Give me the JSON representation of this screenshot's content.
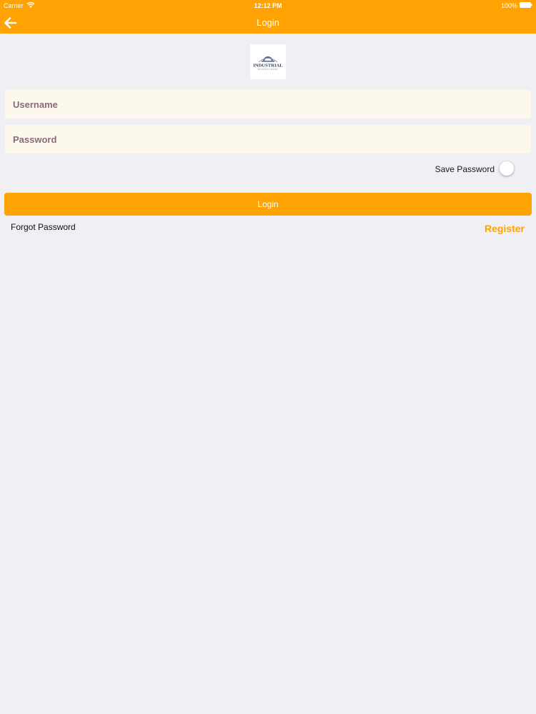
{
  "status_bar": {
    "carrier": "Carrier",
    "time": "12:12 PM",
    "battery": "100%"
  },
  "nav": {
    "title": "Login",
    "back_icon": "arrow-left-icon"
  },
  "logo": {
    "text": "INDUSTRIAL",
    "subtext": "BUSINESS CREDIT"
  },
  "form": {
    "username_placeholder": "Username",
    "username_value": "",
    "password_placeholder": "Password",
    "password_value": "",
    "save_password_label": "Save Password",
    "save_password_on": false,
    "login_label": "Login",
    "forgot_password_label": "Forgot Password",
    "register_label": "Register"
  },
  "colors": {
    "accent": "#ffa304",
    "background": "#efeff4",
    "field_background": "#fcf8ee",
    "placeholder_text": "#8b6a78"
  }
}
